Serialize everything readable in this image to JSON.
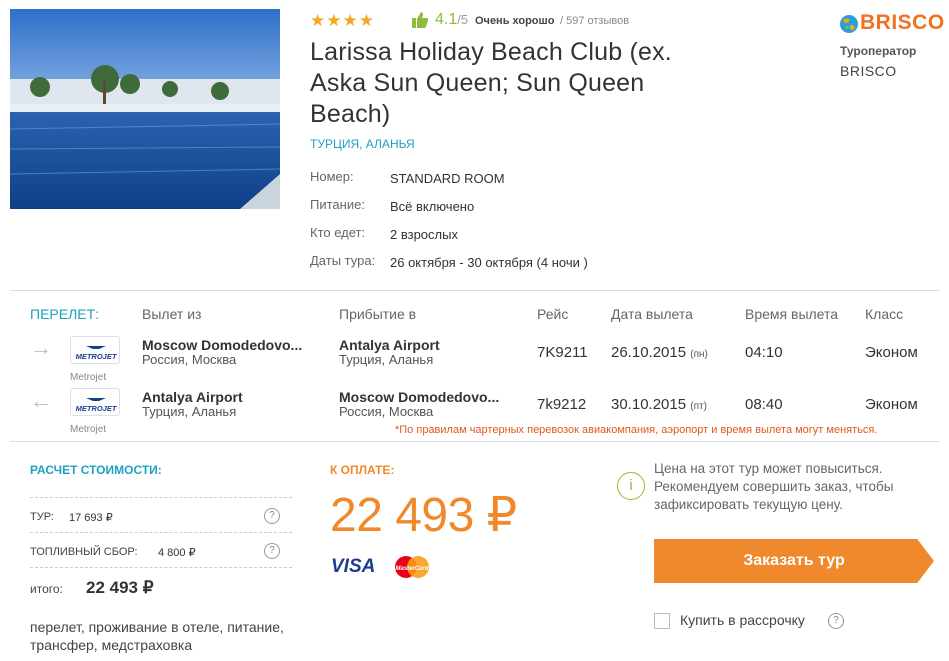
{
  "hotel": {
    "stars": "★★★★",
    "score": "4.1",
    "score_max": "/5",
    "score_text": "Очень хорошо",
    "reviews": "/ 597 отзывов",
    "title": "Larissa Holiday Beach Club (ex. Aska Sun Queen; Sun Queen Beach)",
    "location": "ТУРЦИЯ, АЛАНЬЯ",
    "info": [
      {
        "label": "Номер:",
        "value": "STANDARD ROOM"
      },
      {
        "label": "Питание:",
        "value": "Всё включено"
      },
      {
        "label": "Кто едет:",
        "value": "2 взрослых"
      },
      {
        "label": "Даты тура:",
        "value": "26 октября - 30 октября (4 ночи )"
      }
    ]
  },
  "operator": {
    "logo_text": "BRISCO",
    "label": "Туроператор",
    "name": "BRISCO"
  },
  "flights": {
    "headers": {
      "section": "ПЕРЕЛЕТ:",
      "from": "Вылет из",
      "to": "Прибытие в",
      "flight": "Рейс",
      "date": "Дата вылета",
      "time": "Время вылета",
      "class": "Класс"
    },
    "rows": [
      {
        "direction_icon": "arrow-right-icon",
        "arrow": "→",
        "airline_logo": "METROJET",
        "airline": "Metrojet",
        "from": "Moscow Domodedovo...",
        "from_sub": "Россия, Москва",
        "to": "Antalya Airport",
        "to_sub": "Турция, Аланья",
        "flight": "7K9211",
        "date": "26.10.2015",
        "day": "(пн)",
        "time": "04:10",
        "class": "Эконом"
      },
      {
        "direction_icon": "arrow-left-icon",
        "arrow": "←",
        "airline_logo": "METROJET",
        "airline": "Metrojet",
        "from": "Antalya Airport",
        "from_sub": "Турция, Аланья",
        "to": "Moscow Domodedovo...",
        "to_sub": "Россия, Москва",
        "flight": "7k9212",
        "date": "30.10.2015",
        "day": "(пт)",
        "time": "08:40",
        "class": "Эконом"
      }
    ],
    "note": "*По правилам чартерных перевозок авиакомпания, аэропорт и время вылета могут меняться."
  },
  "cost": {
    "title": "РАСЧЕТ СТОИМОСТИ:",
    "tour_label": "ТУР:",
    "tour_value": "17 693 ₽",
    "fuel_label": "ТОПЛИВНЫЙ СБОР:",
    "fuel_value": "4 800 ₽",
    "help": "?",
    "total_label": "итого:",
    "total_value": "22 493 ₽",
    "includes": "перелет, проживание в отеле, питание, трансфер, медстраховка"
  },
  "payment": {
    "title": "К ОПЛАТЕ:",
    "price": "22 493 ₽",
    "visa": "VISA",
    "mastercard": "MasterCard"
  },
  "order": {
    "info_icon": "i",
    "warning": "Цена на этот тур может повыситься. Рекомендуем совершить заказ, чтобы зафиксировать текущую цену.",
    "button": "Заказать тур",
    "installment": "Купить в рассрочку",
    "help": "?"
  },
  "colors": {
    "accent_blue": "#1ea0c3",
    "accent_orange": "#f0892c",
    "green": "#8dbd3c",
    "note_red": "#e2581f"
  }
}
